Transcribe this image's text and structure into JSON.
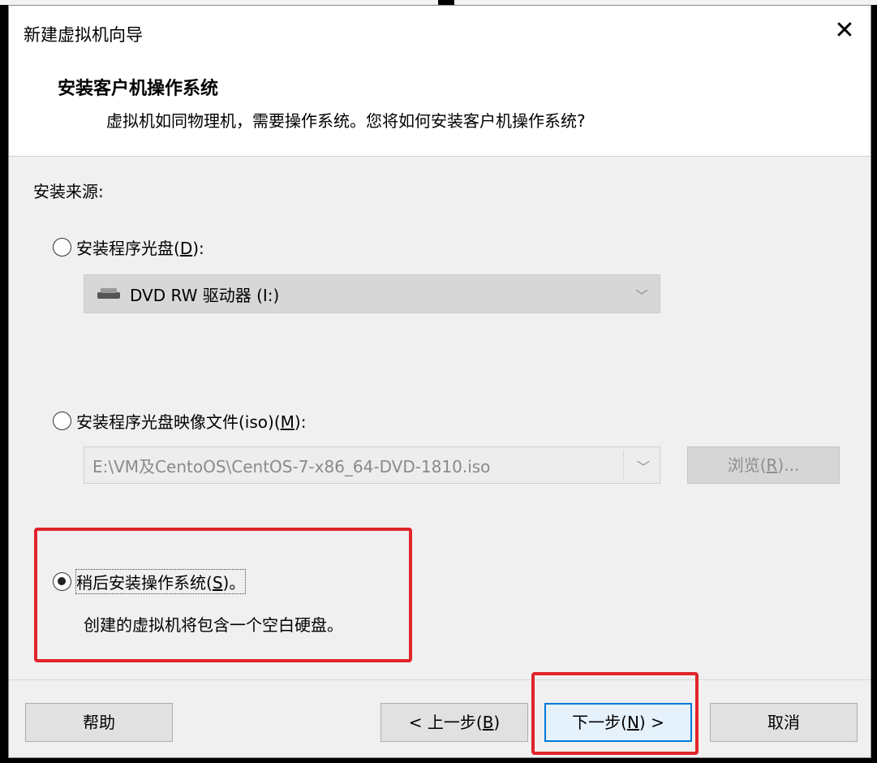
{
  "window": {
    "title": "新建虚拟机向导",
    "close_symbol": "✕"
  },
  "header": {
    "title": "安装客户机操作系统",
    "subtitle": "虚拟机如同物理机，需要操作系统。您将如何安装客户机操作系统?"
  },
  "install_source": {
    "label": "安装来源:",
    "options": [
      {
        "label_prefix": "安装程序光盘(",
        "mnemonic": "D",
        "label_suffix": "):",
        "selected": false,
        "combo_value": "DVD RW 驱动器 (I:)",
        "combo_icon": "dvd-drive-icon"
      },
      {
        "label_prefix": "安装程序光盘映像文件(iso)(",
        "mnemonic": "M",
        "label_suffix": "):",
        "selected": false,
        "combo_value": "E:\\VM及CentoOS\\CentOS-7-x86_64-DVD-1810.iso",
        "browse_prefix": "浏览(",
        "browse_mnemonic": "R",
        "browse_suffix": ")..."
      },
      {
        "label_prefix": "稍后安装操作系统(",
        "mnemonic": "S",
        "label_suffix": ")。",
        "selected": true,
        "description": "创建的虚拟机将包含一个空白硬盘。"
      }
    ]
  },
  "footer": {
    "help": "帮助",
    "back_prefix": "< 上一步(",
    "back_mnemonic": "B",
    "back_suffix": ")",
    "next_prefix": "下一步(",
    "next_mnemonic": "N",
    "next_suffix": ") >",
    "cancel": "取消"
  },
  "colors": {
    "highlight_border": "#e0242a",
    "default_button_border": "#0078d7"
  }
}
